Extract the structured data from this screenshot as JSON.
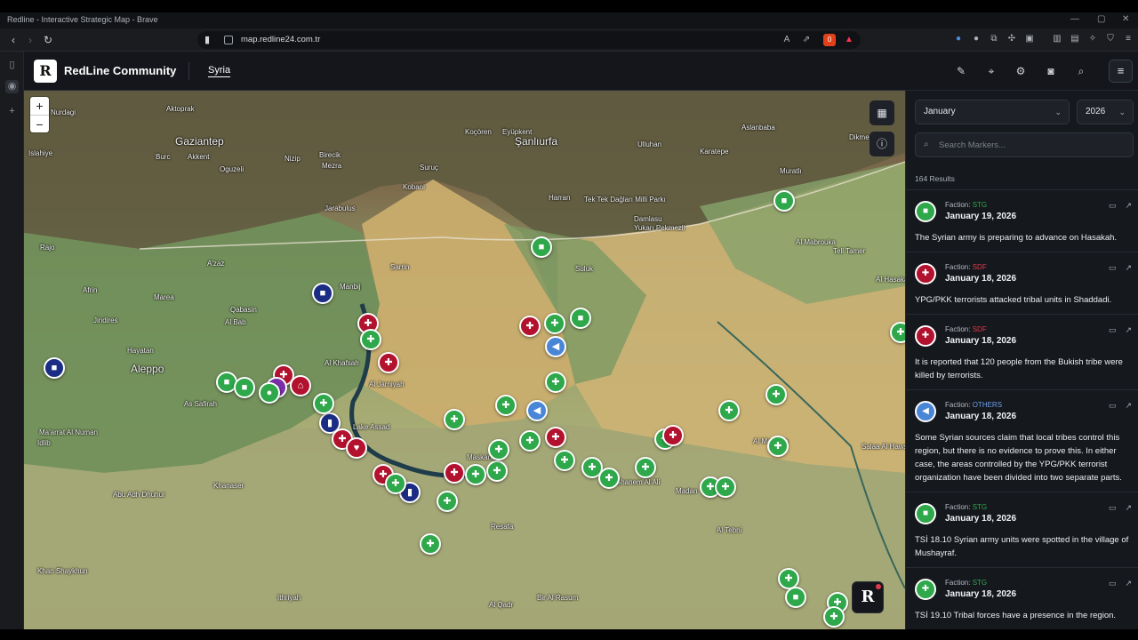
{
  "window": {
    "title": "Redline - Interactive Strategic Map - Brave"
  },
  "browser": {
    "url": "map.redline24.com.tr",
    "shield_badge": "0"
  },
  "app": {
    "logo_letter": "R",
    "brand": "RedLine Community",
    "active_tab": "Syria"
  },
  "map": {
    "zoom_in": "+",
    "zoom_out": "−",
    "badge_letter": "R",
    "places": [
      {
        "name": "Nurdagi"
      },
      {
        "name": "Aktoprak"
      },
      {
        "name": "Gaziantep",
        "big": true
      },
      {
        "name": "Burc"
      },
      {
        "name": "Akkent"
      },
      {
        "name": "Islahiye"
      },
      {
        "name": "Oguzeli"
      },
      {
        "name": "Nizip"
      },
      {
        "name": "Birecik"
      },
      {
        "name": "Mezra"
      },
      {
        "name": "Şanlıurfa",
        "big": true
      },
      {
        "name": "Koçören"
      },
      {
        "name": "Eyüpkent"
      },
      {
        "name": "Suruç"
      },
      {
        "name": "Harran"
      },
      {
        "name": "Ulluhan"
      },
      {
        "name": "Karatepe"
      },
      {
        "name": "Aslanbaba"
      },
      {
        "name": "Dikme"
      },
      {
        "name": "Muratlı"
      },
      {
        "name": "Jarabulus"
      },
      {
        "name": "Kobani"
      },
      {
        "name": "Tek Tek Dağları Milli Parkı"
      },
      {
        "name": "Damlasu"
      },
      {
        "name": "Yukarı Pekmezli"
      },
      {
        "name": "Rajo"
      },
      {
        "name": "Afrin"
      },
      {
        "name": "Marea"
      },
      {
        "name": "A'zaz"
      },
      {
        "name": "Qabasin"
      },
      {
        "name": "Al Bab"
      },
      {
        "name": "Manbij"
      },
      {
        "name": "Jindires"
      },
      {
        "name": "Hayatan"
      },
      {
        "name": "Aleppo",
        "big": true
      },
      {
        "name": "As Safirah"
      },
      {
        "name": "Al Khafsah"
      },
      {
        "name": "Al Jarniyah"
      },
      {
        "name": "Sarrin"
      },
      {
        "name": "Suluk"
      },
      {
        "name": "Al Mabrouka"
      },
      {
        "name": "Tell Tamer"
      },
      {
        "name": "Al Hasakah"
      },
      {
        "name": "Maskanah"
      },
      {
        "name": "Lake Assad"
      },
      {
        "name": "Khanaser"
      },
      {
        "name": "Abu Adh Dhuhur"
      },
      {
        "name": "Al Mayadin"
      },
      {
        "name": "Salaa Al Hawsha"
      },
      {
        "name": "Ithriyah"
      },
      {
        "name": "Al Qadr"
      },
      {
        "name": "Resafa"
      },
      {
        "name": "Ghanem Al Ali"
      },
      {
        "name": "Madan"
      },
      {
        "name": "Al Tebni"
      },
      {
        "name": "Ma'arrat Al Numan"
      },
      {
        "name": "Khan Shaykhun"
      },
      {
        "name": "Idlib"
      },
      {
        "name": "Bir Al Rasum"
      }
    ],
    "tools": {
      "layers_icon": "map-icon",
      "info_icon": "info-icon"
    }
  },
  "panel": {
    "month": "January",
    "year": "2026",
    "search_placeholder": "Search Markers...",
    "results_count": "164 Results",
    "faction_label": "Faction:",
    "feed": [
      {
        "faction": "STG",
        "color": "#2ea84a",
        "icon": "truck-icon",
        "date": "January 19, 2026",
        "text": "The Syrian army is preparing to advance on Hasakah."
      },
      {
        "faction": "SDF",
        "color": "#b3122e",
        "icon": "rifle-icon",
        "date": "January 18, 2026",
        "text": "YPG/PKK terrorists attacked tribal units in Shaddadi."
      },
      {
        "faction": "SDF",
        "color": "#b3122e",
        "icon": "rifle-icon",
        "date": "January 18, 2026",
        "text": "It is reported that 120 people from the Bukish tribe were killed by terrorists."
      },
      {
        "faction": "OTHERS",
        "color": "#4a86d6",
        "icon": "megaphone-icon",
        "date": "January 18, 2026",
        "text": "Some Syrian sources claim that local tribes control this region, but there is no evidence to prove this. In either case, the areas controlled by the YPG/PKK terrorist organization have been divided into two separate parts."
      },
      {
        "faction": "STG",
        "color": "#2ea84a",
        "icon": "truck-icon",
        "date": "January 18, 2026",
        "text": "TSİ 18.10 Syrian army units were spotted in the village of Mushayraf."
      },
      {
        "faction": "STG",
        "color": "#2ea84a",
        "icon": "rifle-icon",
        "date": "January 18, 2026",
        "text": "TSİ 19.10 Tribal forces have a presence in the region."
      }
    ]
  }
}
